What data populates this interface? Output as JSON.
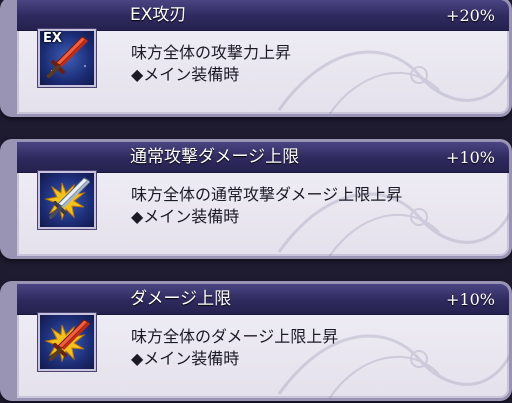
{
  "abilities": [
    {
      "title": "EX攻刃",
      "value": "+20%",
      "icon": "red-sword-icon",
      "badge": "EX",
      "desc_line1": "味方全体の攻撃力上昇",
      "desc_line2": "◆メイン装備時"
    },
    {
      "title": "通常攻撃ダメージ上限",
      "value": "+10%",
      "icon": "silver-sword-burst-icon",
      "desc_line1": "味方全体の通常攻撃ダメージ上限上昇",
      "desc_line2": "◆メイン装備時"
    },
    {
      "title": "ダメージ上限",
      "value": "+10%",
      "icon": "red-sword-burst-icon",
      "desc_line1": "味方全体のダメージ上限上昇",
      "desc_line2": "◆メイン装備時"
    }
  ],
  "colors": {
    "header": "#2e2a5e",
    "card_body": "#ebe8f1",
    "border": "#9a94b4",
    "sword_red": "#e8402a",
    "burst_yellow": "#f2c21e",
    "icon_bg": "#1d2e78"
  }
}
